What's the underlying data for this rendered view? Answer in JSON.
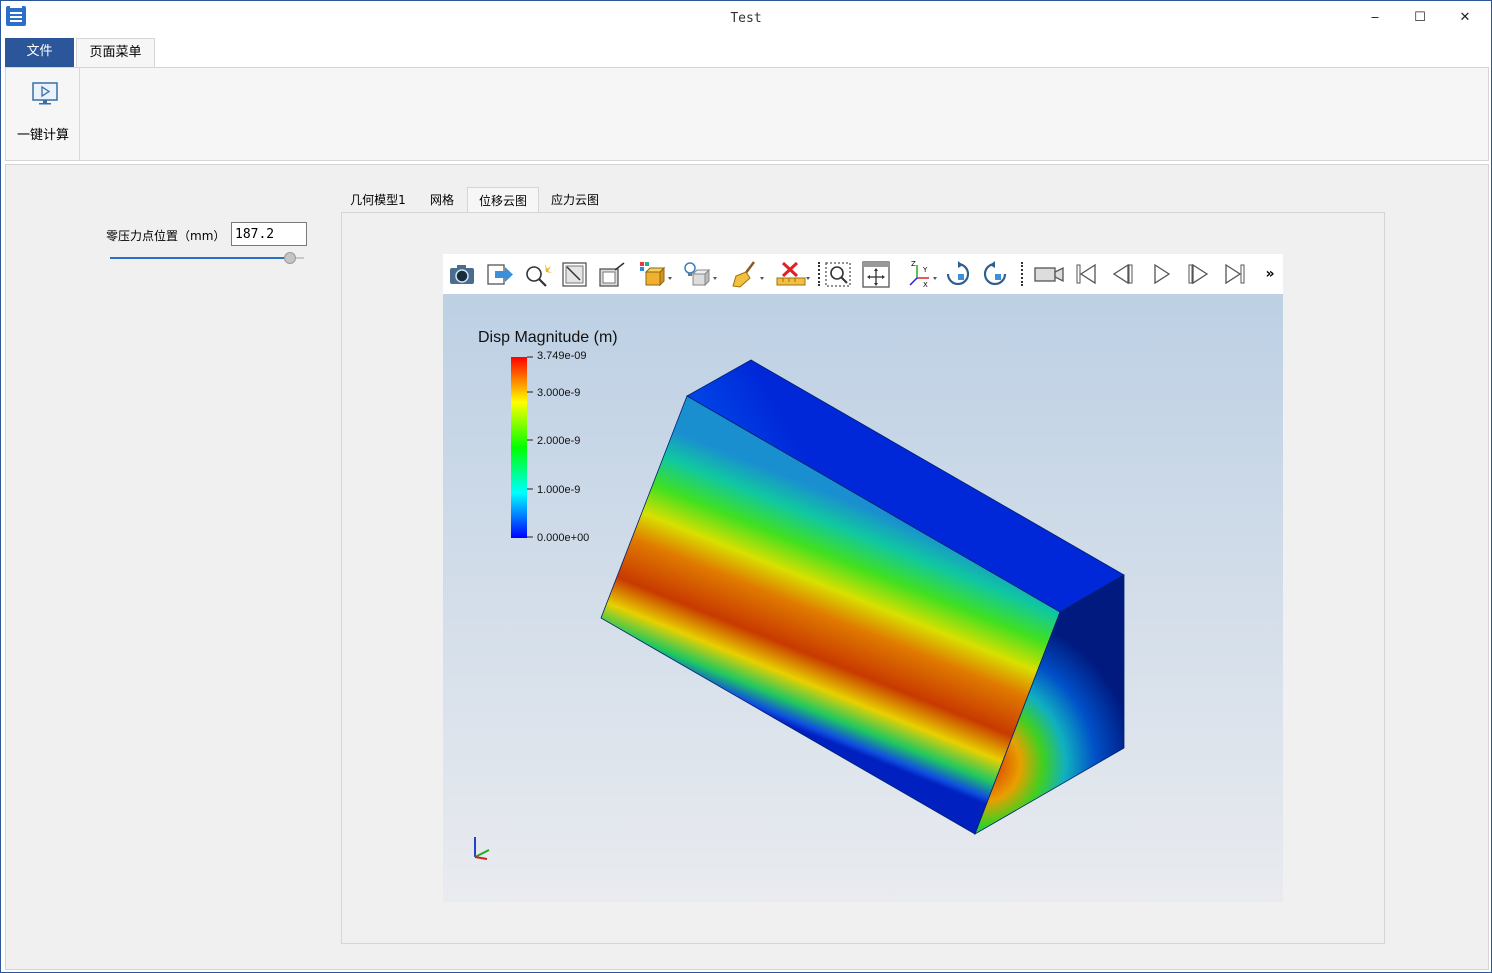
{
  "window": {
    "title": "Test",
    "minimize_glyph": "‒",
    "maximize_glyph": "☐",
    "close_glyph": "✕"
  },
  "ribbon": {
    "tabs": [
      {
        "label": "文件",
        "active": false
      },
      {
        "label": "页面菜单",
        "active": true
      }
    ],
    "buttons": [
      {
        "label": "一键计算",
        "icon": "monitor-play-icon"
      }
    ]
  },
  "params": {
    "label": "零压力点位置（mm）",
    "value": "187.2",
    "slider_fraction": 0.93
  },
  "view_tabs": [
    {
      "label": "几何模型1",
      "active": false
    },
    {
      "label": "网格",
      "active": false
    },
    {
      "label": "位移云图",
      "active": true
    },
    {
      "label": "应力云图",
      "active": false
    }
  ],
  "toolbar": {
    "icons": [
      "camera-icon",
      "export-arrow-icon",
      "magic-zoom-icon",
      "zoom-fit-icon",
      "zoom-box-icon",
      "display-mode-icon",
      "light-icon",
      "clear-brush-icon",
      "measure-icon",
      "zoom-window-icon",
      "pan-icon",
      "axes-icon",
      "rotate-cw-icon",
      "rotate-ccw-icon",
      "record-camera-icon",
      "first-frame-icon",
      "prev-frame-icon",
      "play-icon",
      "next-frame-icon",
      "last-frame-icon"
    ],
    "more_glyph": "»"
  },
  "legend": {
    "title": "Disp Magnitude (m)",
    "max_label": "3.749e-09",
    "ticks": [
      "3.000e-9",
      "2.000e-9",
      "1.000e-9",
      "0.000e+00"
    ],
    "colors": [
      "#ff0000",
      "#ffff00",
      "#00ff00",
      "#00ffff",
      "#0000ff"
    ]
  },
  "colors": {
    "accent": "#2b579a",
    "slider_fill": "#2b6fc9"
  }
}
